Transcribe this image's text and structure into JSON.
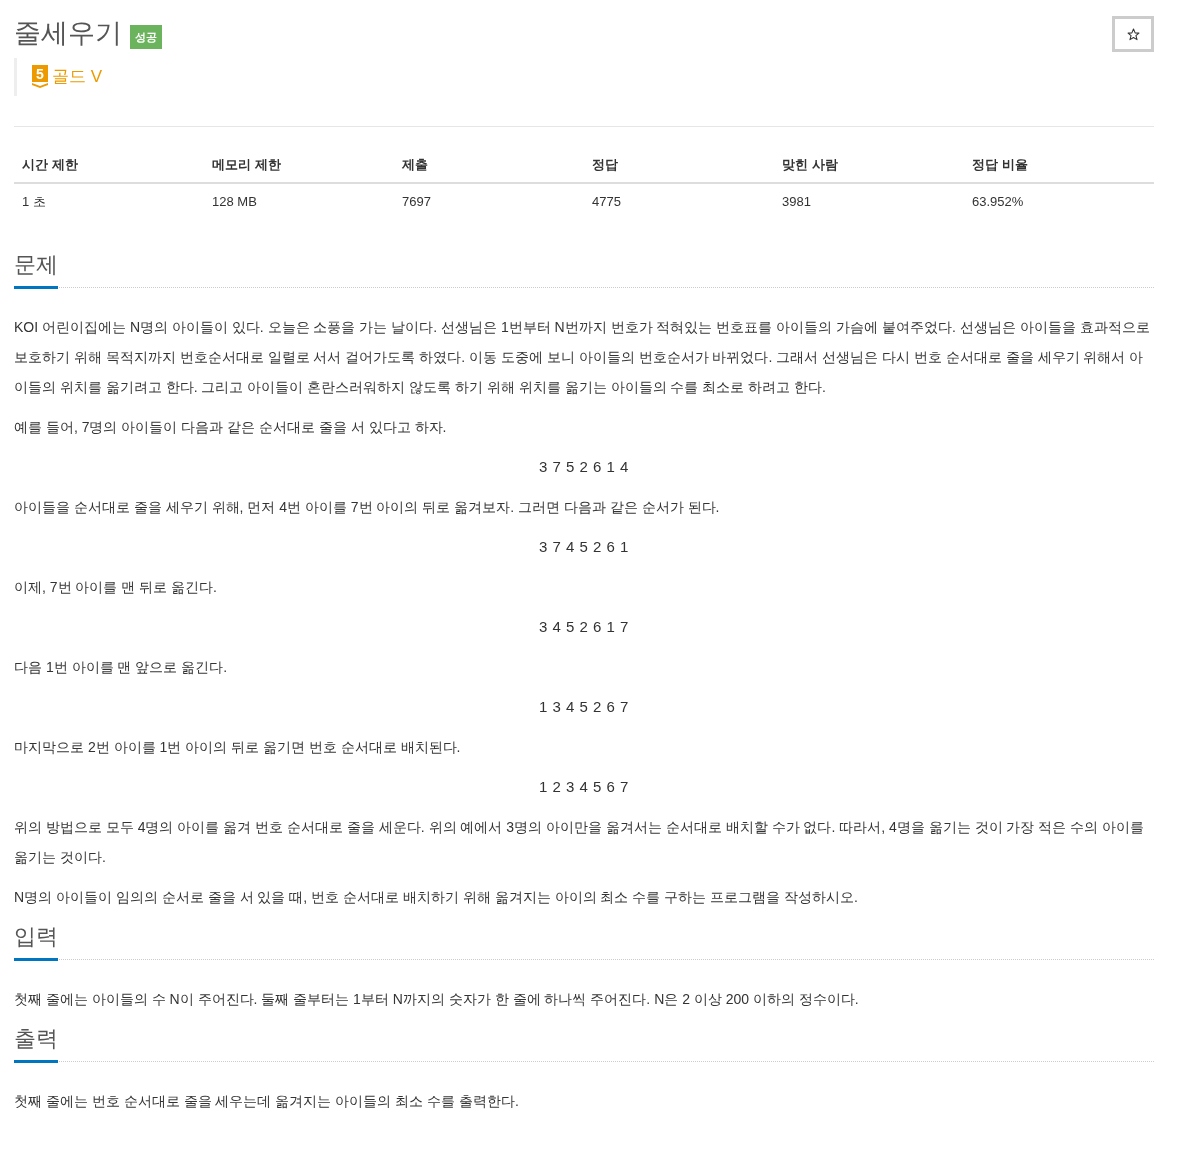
{
  "problem": {
    "title": "줄세우기",
    "result_badge": "성공",
    "starred": false,
    "tier": {
      "number": "5",
      "label": "골드 V"
    }
  },
  "stats": {
    "columns": [
      "시간 제한",
      "메모리 제한",
      "제출",
      "정답",
      "맞힌 사람",
      "정답 비율"
    ],
    "rows": [
      [
        "1 초",
        "128 MB",
        "7697",
        "4775",
        "3981",
        "63.952%"
      ]
    ]
  },
  "sections": [
    {
      "title": "문제",
      "paragraphs": [
        {
          "kind": "text",
          "text": "KOI 어린이집에는 N명의 아이들이 있다. 오늘은 소풍을 가는 날이다. 선생님은 1번부터 N번까지 번호가 적혀있는 번호표를 아이들의 가슴에 붙여주었다. 선생님은 아이들을 효과적으로 보호하기 위해 목적지까지 번호순서대로 일렬로 서서 걸어가도록 하였다. 이동 도중에 보니 아이들의 번호순서가 바뀌었다. 그래서 선생님은 다시 번호 순서대로 줄을 세우기 위해서 아이들의 위치를 옮기려고 한다. 그리고 아이들이 혼란스러워하지 않도록 하기 위해 위치를 옮기는 아이들의 수를 최소로 하려고 한다."
        },
        {
          "kind": "text",
          "text": "예를 들어, 7명의 아이들이 다음과 같은 순서대로 줄을 서 있다고 하자."
        },
        {
          "kind": "sequence",
          "text": "3 7 5 2 6 1 4"
        },
        {
          "kind": "text",
          "text": "아이들을 순서대로 줄을 세우기 위해, 먼저 4번 아이를 7번 아이의 뒤로 옮겨보자. 그러면 다음과 같은 순서가 된다."
        },
        {
          "kind": "sequence",
          "text": "3 7 4 5 2 6 1"
        },
        {
          "kind": "text",
          "text": "이제, 7번 아이를 맨 뒤로 옮긴다."
        },
        {
          "kind": "sequence",
          "text": "3 4 5 2 6 1 7"
        },
        {
          "kind": "text",
          "text": "다음 1번 아이를 맨 앞으로 옮긴다."
        },
        {
          "kind": "sequence",
          "text": "1 3 4 5 2 6 7"
        },
        {
          "kind": "text",
          "text": "마지막으로 2번 아이를 1번 아이의 뒤로 옮기면 번호 순서대로 배치된다."
        },
        {
          "kind": "sequence",
          "text": "1 2 3 4 5 6 7"
        },
        {
          "kind": "text",
          "text": "위의 방법으로 모두 4명의 아이를 옮겨 번호 순서대로 줄을 세운다. 위의 예에서 3명의 아이만을 옮겨서는 순서대로 배치할 수가 없다. 따라서, 4명을 옮기는 것이 가장 적은 수의 아이를 옮기는 것이다."
        },
        {
          "kind": "text",
          "text": "N명의 아이들이 임의의 순서로 줄을 서 있을 때, 번호 순서대로 배치하기 위해 옮겨지는 아이의 최소 수를 구하는 프로그램을 작성하시오."
        }
      ]
    },
    {
      "title": "입력",
      "paragraphs": [
        {
          "kind": "text",
          "text": "첫째 줄에는 아이들의 수 N이 주어진다. 둘째 줄부터는 1부터 N까지의 숫자가 한 줄에 하나씩 주어진다. N은 2 이상 200 이하의 정수이다."
        }
      ]
    },
    {
      "title": "출력",
      "paragraphs": [
        {
          "kind": "text",
          "text": "첫째 줄에는 번호 순서대로 줄을 세우는데 옮겨지는 아이들의 최소 수를 출력한다."
        }
      ]
    }
  ]
}
